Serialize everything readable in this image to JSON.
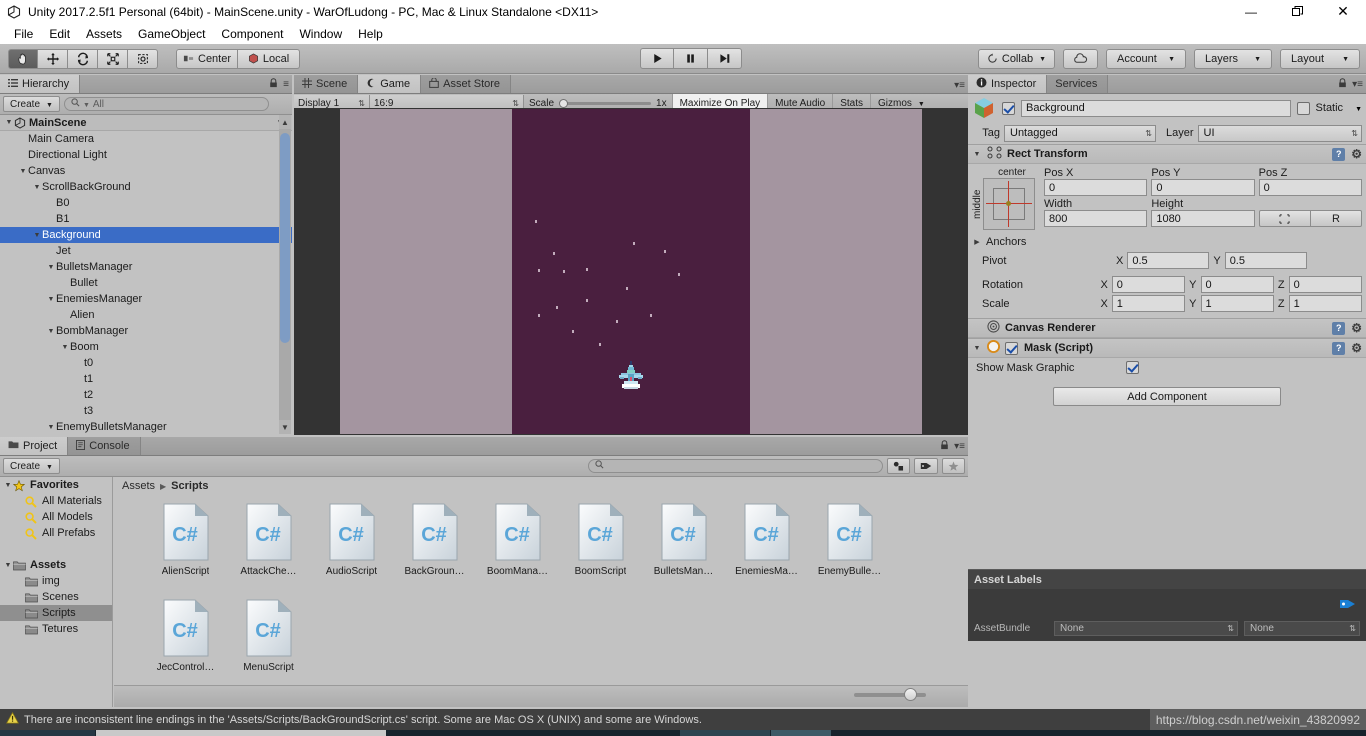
{
  "window": {
    "title": "Unity 2017.2.5f1 Personal (64bit) - MainScene.unity - WarOfLudong - PC, Mac & Linux Standalone <DX11>",
    "app_icon": "unity-logo-icon",
    "minimize": "—",
    "maximize": "❐",
    "close": "✕"
  },
  "menu": {
    "items": [
      "File",
      "Edit",
      "Assets",
      "GameObject",
      "Component",
      "Window",
      "Help"
    ]
  },
  "toolbar": {
    "transform_tools": [
      {
        "name": "hand-tool",
        "glyph": "✋",
        "active": true
      },
      {
        "name": "move-tool",
        "glyph": "✥",
        "active": false
      },
      {
        "name": "rotate-tool",
        "glyph": "↻",
        "active": false
      },
      {
        "name": "scale-tool",
        "glyph": "⤡",
        "active": false
      },
      {
        "name": "rect-tool",
        "glyph": "▣",
        "active": false
      }
    ],
    "pivot_mode": "Center",
    "pivot_rotation": "Local",
    "play": "▶",
    "pause": "‖",
    "step": "▶|",
    "collab": "Collab",
    "cloud": "cloud-icon",
    "account": "Account",
    "layers": "Layers",
    "layout": "Layout"
  },
  "hierarchy": {
    "tabs": [
      {
        "label": "Hierarchy",
        "icon": "hierarchy-icon",
        "active": true
      }
    ],
    "create_button": "Create",
    "search_placeholder": "All",
    "scene_name": "MainScene",
    "items": [
      {
        "label": "Main Camera",
        "depth": 1,
        "expand": "none",
        "selected": false
      },
      {
        "label": "Directional Light",
        "depth": 1,
        "expand": "none",
        "selected": false
      },
      {
        "label": "Canvas",
        "depth": 1,
        "expand": "expanded",
        "selected": false
      },
      {
        "label": "ScrollBackGround",
        "depth": 2,
        "expand": "expanded",
        "selected": false
      },
      {
        "label": "B0",
        "depth": 3,
        "expand": "none",
        "selected": false
      },
      {
        "label": "B1",
        "depth": 3,
        "expand": "none",
        "selected": false
      },
      {
        "label": "Background",
        "depth": 2,
        "expand": "expanded",
        "selected": true
      },
      {
        "label": "Jet",
        "depth": 3,
        "expand": "none",
        "selected": false
      },
      {
        "label": "BulletsManager",
        "depth": 3,
        "expand": "expanded",
        "selected": false
      },
      {
        "label": "Bullet",
        "depth": 4,
        "expand": "none",
        "selected": false
      },
      {
        "label": "EnemiesManager",
        "depth": 3,
        "expand": "expanded",
        "selected": false
      },
      {
        "label": "Alien",
        "depth": 4,
        "expand": "none",
        "selected": false
      },
      {
        "label": "BombManager",
        "depth": 3,
        "expand": "expanded",
        "selected": false
      },
      {
        "label": "Boom",
        "depth": 4,
        "expand": "expanded",
        "selected": false
      },
      {
        "label": "t0",
        "depth": 5,
        "expand": "none",
        "selected": false
      },
      {
        "label": "t1",
        "depth": 5,
        "expand": "none",
        "selected": false
      },
      {
        "label": "t2",
        "depth": 5,
        "expand": "none",
        "selected": false
      },
      {
        "label": "t3",
        "depth": 5,
        "expand": "none",
        "selected": false
      },
      {
        "label": "EnemyBulletsManager",
        "depth": 3,
        "expand": "expanded",
        "selected": false
      }
    ]
  },
  "gameview": {
    "tabs": [
      {
        "label": "Scene",
        "icon": "grid-icon",
        "active": false
      },
      {
        "label": "Game",
        "icon": "gamepad-icon",
        "active": true
      },
      {
        "label": "Asset Store",
        "icon": "store-icon",
        "active": false
      }
    ],
    "display": "Display 1",
    "aspect": "16:9",
    "scale_label": "Scale",
    "scale_value": "1x",
    "maximize_on_play": "Maximize On Play",
    "mute_audio": "Mute Audio",
    "stats": "Stats",
    "gizmos": "Gizmos",
    "colors": {
      "letterbox": "#333333",
      "canvas_gray": "#a495a0",
      "game_background": "#4a1f3f"
    }
  },
  "inspector": {
    "tabs": [
      {
        "label": "Inspector",
        "icon": "info-icon",
        "active": true
      },
      {
        "label": "Services",
        "icon": "cloud-icon",
        "active": false
      }
    ],
    "object_name": "Background",
    "object_enabled": true,
    "static_label": "Static",
    "static_checked": false,
    "tag_label": "Tag",
    "tag_value": "Untagged",
    "layer_label": "Layer",
    "layer_value": "UI",
    "rect_transform": {
      "title": "Rect Transform",
      "anchor_preset_top": "center",
      "anchor_preset_side": "middle",
      "pos_x_label": "Pos X",
      "pos_x": "0",
      "pos_y_label": "Pos Y",
      "pos_y": "0",
      "pos_z_label": "Pos Z",
      "pos_z": "0",
      "width_label": "Width",
      "width": "800",
      "height_label": "Height",
      "height": "1080",
      "blueprint_btn": "⬚",
      "raw_btn": "R",
      "anchors_label": "Anchors",
      "pivot_label": "Pivot",
      "pivot_x": "0.5",
      "pivot_y": "0.5",
      "rotation_label": "Rotation",
      "rot_x": "0",
      "rot_y": "0",
      "rot_z": "0",
      "scale_label": "Scale",
      "scale_x": "1",
      "scale_y": "1",
      "scale_z": "1",
      "x": "X",
      "y": "Y",
      "z": "Z"
    },
    "canvas_renderer": {
      "title": "Canvas Renderer"
    },
    "mask": {
      "title": "Mask (Script)",
      "enabled": true,
      "show_mask_graphic_label": "Show Mask Graphic",
      "show_mask_graphic": true
    },
    "add_component": "Add Component",
    "asset_labels": {
      "title": "Asset Labels",
      "assetbundle_label": "AssetBundle",
      "bundle_value": "None",
      "variant_value": "None",
      "tag_icon": "label-tag-icon"
    }
  },
  "project": {
    "tabs": [
      {
        "label": "Project",
        "icon": "folder-icon",
        "active": true
      },
      {
        "label": "Console",
        "icon": "console-icon",
        "active": false
      }
    ],
    "create_button": "Create",
    "search_placeholder": "",
    "breadcrumb": [
      "Assets",
      "Scripts"
    ],
    "tree": [
      {
        "label": "Favorites",
        "depth": 0,
        "icon": "star-icon",
        "expand": "expanded",
        "bold": true,
        "selected": false
      },
      {
        "label": "All Materials",
        "depth": 1,
        "icon": "search-icon",
        "expand": "none",
        "bold": false,
        "selected": false
      },
      {
        "label": "All Models",
        "depth": 1,
        "icon": "search-icon",
        "expand": "none",
        "bold": false,
        "selected": false
      },
      {
        "label": "All Prefabs",
        "depth": 1,
        "icon": "search-icon",
        "expand": "none",
        "bold": false,
        "selected": false
      },
      {
        "label": "",
        "depth": 0,
        "icon": "none",
        "expand": "none",
        "bold": false,
        "selected": false
      },
      {
        "label": "Assets",
        "depth": 0,
        "icon": "folder-icon",
        "expand": "expanded",
        "bold": true,
        "selected": false
      },
      {
        "label": "img",
        "depth": 1,
        "icon": "folder-icon",
        "expand": "none",
        "bold": false,
        "selected": false
      },
      {
        "label": "Scenes",
        "depth": 1,
        "icon": "folder-icon",
        "expand": "none",
        "bold": false,
        "selected": false
      },
      {
        "label": "Scripts",
        "depth": 1,
        "icon": "folder-icon",
        "expand": "none",
        "bold": false,
        "selected": true
      },
      {
        "label": "Tetures",
        "depth": 1,
        "icon": "folder-icon",
        "expand": "none",
        "bold": false,
        "selected": false
      }
    ],
    "assets": [
      {
        "label": "AlienScript",
        "type": "csharp-script"
      },
      {
        "label": "AttackChe…",
        "type": "csharp-script"
      },
      {
        "label": "AudioScript",
        "type": "csharp-script"
      },
      {
        "label": "BackGroun…",
        "type": "csharp-script"
      },
      {
        "label": "BoomMana…",
        "type": "csharp-script"
      },
      {
        "label": "BoomScript",
        "type": "csharp-script"
      },
      {
        "label": "BulletsMan…",
        "type": "csharp-script"
      },
      {
        "label": "EnemiesMa…",
        "type": "csharp-script"
      },
      {
        "label": "EnemyBulle…",
        "type": "csharp-script"
      },
      {
        "label": "JecControl…",
        "type": "csharp-script"
      },
      {
        "label": "MenuScript",
        "type": "csharp-script"
      }
    ],
    "zoom_slider_value": 62
  },
  "statusbar": {
    "icon": "warning-icon",
    "message": "There are inconsistent line endings in the 'Assets/Scripts/BackGroundScript.cs' script. Some are Mac OS X (UNIX) and some are Windows.",
    "watermark": "https://blog.csdn.net/weixin_43820992"
  }
}
